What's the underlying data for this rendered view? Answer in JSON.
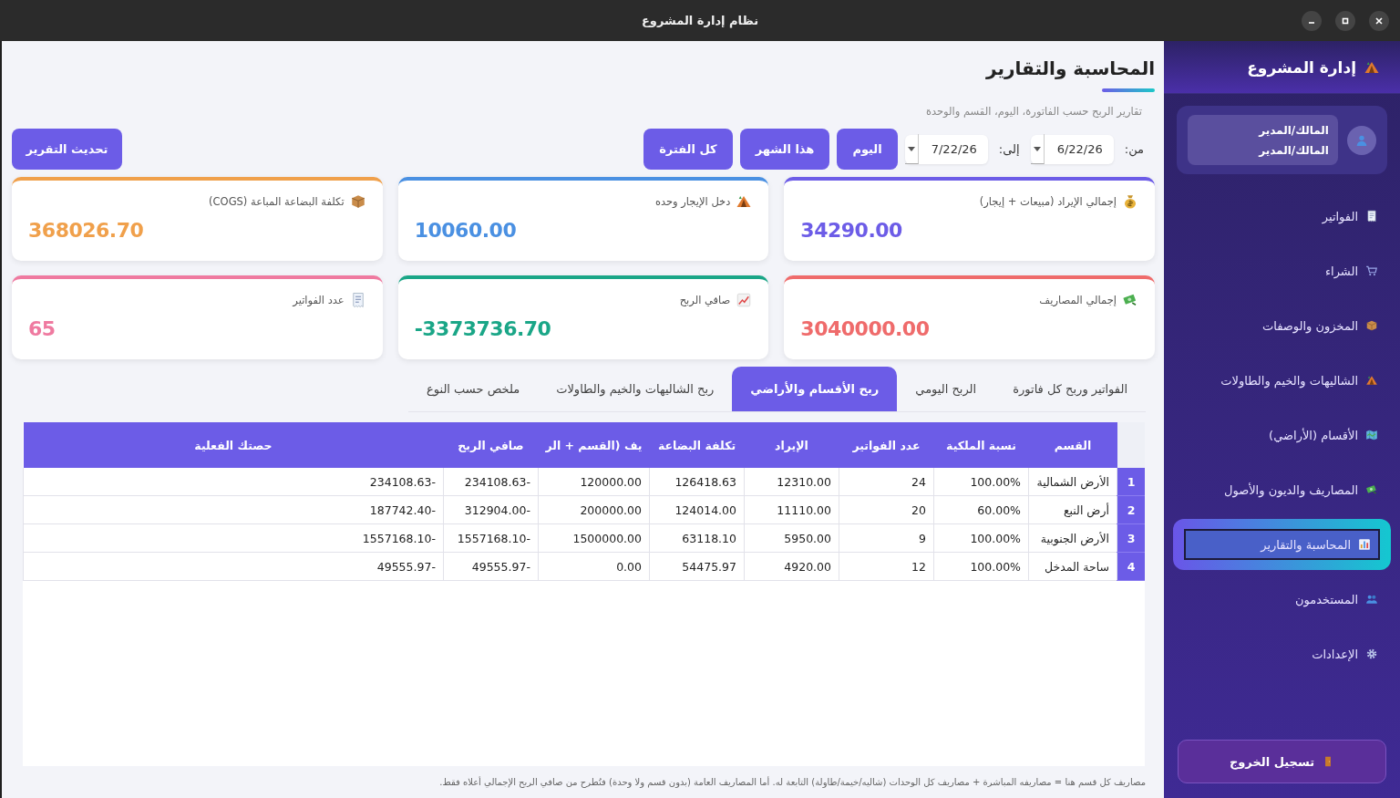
{
  "window": {
    "title": "نظام إدارة المشروع"
  },
  "sidebar": {
    "brand": "إدارة المشروع",
    "user": {
      "name": "المالك/المدير",
      "role": "المالك/المدير"
    },
    "items": [
      {
        "label": "الفواتير",
        "selected": false
      },
      {
        "label": "الشراء",
        "selected": false
      },
      {
        "label": "المخزون والوصفات",
        "selected": false
      },
      {
        "label": "الشاليهات والخيم والطاولات",
        "selected": false
      },
      {
        "label": "الأقسام (الأراضي)",
        "selected": false
      },
      {
        "label": "المصاريف والديون والأصول",
        "selected": false
      },
      {
        "label": "المحاسبة والتقارير",
        "selected": true
      },
      {
        "label": "المستخدمون",
        "selected": false
      },
      {
        "label": "الإعدادات",
        "selected": false
      }
    ],
    "logout": "تسجيل الخروج"
  },
  "page": {
    "title": "المحاسبة والتقارير",
    "subtitle": "تقارير الربح حسب الفاتورة، اليوم، القسم والوحدة"
  },
  "filters": {
    "from_label": "من:",
    "from": "6/22/26",
    "to_label": "إلى:",
    "to": "7/22/26",
    "quick_buttons": [
      "اليوم",
      "هذا الشهر",
      "كل الفترة"
    ],
    "refresh": "تحديث التقرير"
  },
  "cards": [
    {
      "label": "إجمالي الإيراد (مبيعات + إيجار)",
      "value": "34290.00",
      "color": "#6c5ce7"
    },
    {
      "label": "دخل الإيجار وحده",
      "value": "10060.00",
      "color": "#4a90e2"
    },
    {
      "label": "تكلفة البضاعة المباعة (COGS)",
      "value": "368026.70",
      "color": "#f0a04b"
    },
    {
      "label": "إجمالي المصاريف",
      "value": "3040000.00",
      "color": "#ef6b6b"
    },
    {
      "label": "صافي الربح",
      "value": "-3373736.70",
      "color": "#1aa687"
    },
    {
      "label": "عدد الفواتير",
      "value": "65",
      "color": "#ef7aa0"
    }
  ],
  "tabs": [
    {
      "label": "الفواتير وربح كل فاتورة",
      "selected": false
    },
    {
      "label": "الربح اليومي",
      "selected": false
    },
    {
      "label": "ربح الأقسام والأراضي",
      "selected": true
    },
    {
      "label": "ربح الشاليهات والخيم والطاولات",
      "selected": false
    },
    {
      "label": "ملخص حسب النوع",
      "selected": false
    }
  ],
  "table": {
    "columns": [
      "القسم",
      "نسبة الملكية",
      "عدد الفواتير",
      "الإيراد",
      "تكلفة البضاعة",
      "يف (القسم + الر",
      "صافي الربح",
      "حصتك الفعلية"
    ],
    "rows": [
      {
        "number": "1",
        "cells": [
          "الأرض الشمالية",
          "100.00%",
          "24",
          "12310.00",
          "126418.63",
          "120000.00",
          "234108.63-",
          "234108.63-"
        ]
      },
      {
        "number": "2",
        "cells": [
          "أرض النبع",
          "60.00%",
          "20",
          "11110.00",
          "124014.00",
          "200000.00",
          "312904.00-",
          "187742.40-"
        ]
      },
      {
        "number": "3",
        "cells": [
          "الأرض الجنوبية",
          "100.00%",
          "9",
          "5950.00",
          "63118.10",
          "1500000.00",
          "1557168.10-",
          "1557168.10-"
        ]
      },
      {
        "number": "4",
        "cells": [
          "ساحة المدخل",
          "100.00%",
          "12",
          "4920.00",
          "54475.97",
          "0.00",
          "49555.97-",
          "49555.97-"
        ]
      }
    ]
  },
  "note": "مصاريف كل قسم هنا = مصاريفه المباشرة + مصاريف كل الوحدات (شاليه/خيمة/طاولة) التابعة له. أما المصاريف العامة (بدون قسم ولا وحدة) فتُطرح من صافي الربح الإجمالي أعلاه فقط."
}
